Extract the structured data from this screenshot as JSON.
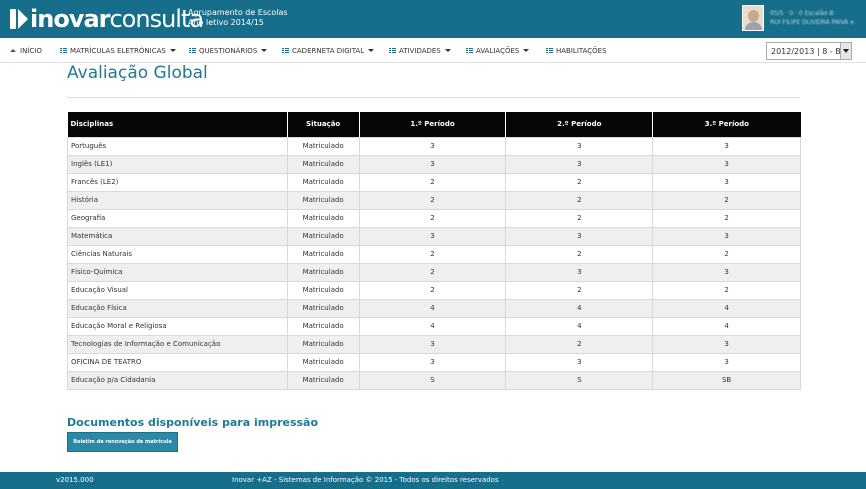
{
  "header": {
    "logo_bold": "inovar",
    "logo_light": "consulta",
    "school_name": "Agrupamento de Escolas",
    "school_year": "Ano letivo 2014/15",
    "user_line1": "05/5 · 0 · 0          Escalão B",
    "user_line2": "RUI FILIPE OLIVEIRA PAIVA e"
  },
  "nav": {
    "items": [
      {
        "label": "INÍCIO",
        "icon": "home-icon"
      },
      {
        "label": "MATRÍCULAS ELETRÓNICAS",
        "icon": "list-icon"
      },
      {
        "label": "QUESTIONÁRIOS",
        "icon": "list-icon"
      },
      {
        "label": "CADERNETA DIGITAL",
        "icon": "list-icon"
      },
      {
        "label": "ATIVIDADES",
        "icon": "list-icon"
      },
      {
        "label": "AVALIAÇÕES",
        "icon": "list-icon"
      },
      {
        "label": "HABILITAÇÕES",
        "icon": "list-icon"
      }
    ],
    "year_select": "2012/2013 | 8 - B"
  },
  "main": {
    "title": "Avaliação Global",
    "table": {
      "headers": [
        "Disciplinas",
        "Situação",
        "1.º Período",
        "2.º Período",
        "3.º Período"
      ],
      "rows": [
        [
          "Português",
          "Matriculado",
          "3",
          "3",
          "3"
        ],
        [
          "Inglês (LE1)",
          "Matriculado",
          "3",
          "3",
          "3"
        ],
        [
          "Francês (LE2)",
          "Matriculado",
          "2",
          "2",
          "3"
        ],
        [
          "História",
          "Matriculado",
          "2",
          "2",
          "2"
        ],
        [
          "Geografia",
          "Matriculado",
          "2",
          "2",
          "2"
        ],
        [
          "Matemática",
          "Matriculado",
          "3",
          "3",
          "3"
        ],
        [
          "Ciências Naturais",
          "Matriculado",
          "2",
          "2",
          "2"
        ],
        [
          "Físico-Química",
          "Matriculado",
          "2",
          "3",
          "3"
        ],
        [
          "Educação Visual",
          "Matriculado",
          "2",
          "2",
          "2"
        ],
        [
          "Educação Física",
          "Matriculado",
          "4",
          "4",
          "4"
        ],
        [
          "Educação Moral e Religiosa",
          "Matriculado",
          "4",
          "4",
          "4"
        ],
        [
          "Tecnologias de Informação e Comunicação",
          "Matriculado",
          "3",
          "2",
          "3"
        ],
        [
          "OFICINA DE TEATRO",
          "Matriculado",
          "3",
          "3",
          "3"
        ],
        [
          "Educação p/a Cidadania",
          "Matriculado",
          "S",
          "S",
          "SB"
        ]
      ]
    },
    "docs_title": "Documentos disponíveis para impressão",
    "docs_button": "Boletim de renovação de matrícula"
  },
  "footer": {
    "version": "v2015.000",
    "copyright": "Inovar +AZ - Sistemas de Informação © 2015 - Todos os direitos reservados"
  },
  "colors": {
    "brand": "#176e8a",
    "title": "#1f7a96",
    "table_header": "#060606"
  }
}
